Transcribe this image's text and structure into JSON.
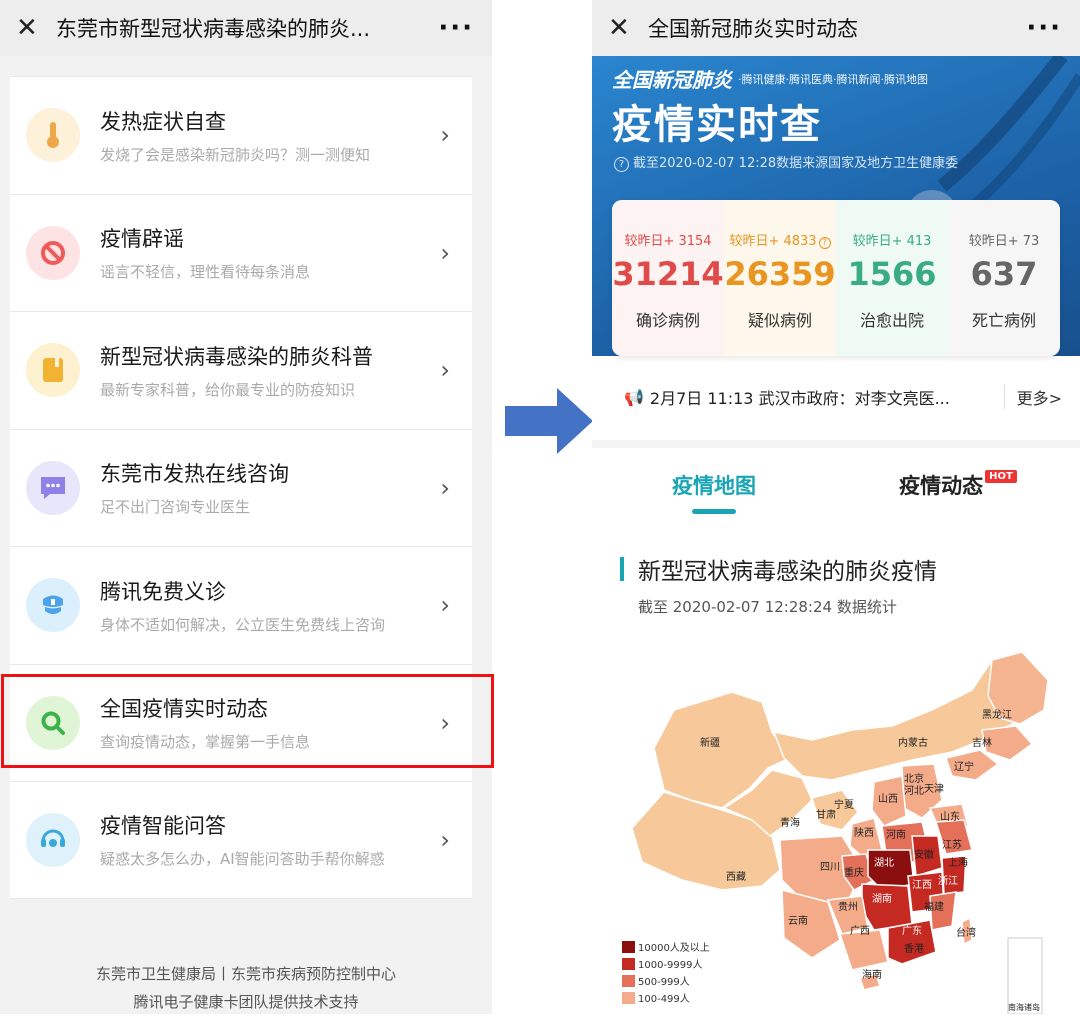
{
  "left": {
    "topbar": {
      "close_icon": "close-icon",
      "title": "东莞市新型冠状病毒感染的肺炎...",
      "more": "···"
    },
    "items": [
      {
        "title": "发热症状自查",
        "subtitle": "发烧了会是感染新冠肺炎吗？测一测便知",
        "icon": "thermometer-icon",
        "bg": "#fdf1d9",
        "fg": "#f0a64a"
      },
      {
        "title": "疫情辟谣",
        "subtitle": "谣言不轻信，理性看待每条消息",
        "icon": "prohibited-icon",
        "bg": "#fde3e3",
        "fg": "#ee5b5b"
      },
      {
        "title": "新型冠状病毒感染的肺炎科普",
        "subtitle": "最新专家科普，给你最专业的防疫知识",
        "icon": "book-icon",
        "bg": "#fdf1cf",
        "fg": "#f3b332"
      },
      {
        "title": "东莞市发热在线咨询",
        "subtitle": "足不出门咨询专业医生",
        "icon": "chat-icon",
        "bg": "#e8e6fa",
        "fg": "#8e82e8"
      },
      {
        "title": "腾讯免费义诊",
        "subtitle": "身体不适如何解决，公立医生免费线上咨询",
        "icon": "doctor-icon",
        "bg": "#dceffd",
        "fg": "#4da3ea"
      },
      {
        "title": "全国疫情实时动态",
        "subtitle": "查询疫情动态，掌握第一手信息",
        "icon": "search-icon",
        "bg": "#dff5d6",
        "fg": "#3db24a"
      },
      {
        "title": "疫情智能问答",
        "subtitle": "疑惑太多怎么办，AI智能问答助手帮你解惑",
        "icon": "robot-icon",
        "bg": "#dff1fb",
        "fg": "#3aa7d9"
      }
    ],
    "footer": {
      "line1": "东莞市卫生健康局丨东莞市疾病预防控制中心",
      "line2": "腾讯电子健康卡团队提供技术支持"
    },
    "highlight_color": "#e11111"
  },
  "arrow_color": "#4472c4",
  "right": {
    "topbar": {
      "close_icon": "close-icon",
      "title": "全国新冠肺炎实时动态",
      "more": "···"
    },
    "banner": {
      "title_small": "全国新冠肺炎",
      "partners": "·腾讯健康·腾讯医典·腾讯新闻·腾讯地图",
      "title_big": "疫情实时查",
      "date_line": "截至2020-02-07 12:28数据来源国家及地方卫生健康委"
    },
    "stats": [
      {
        "delta": "较昨日+ 3154",
        "value": "31214",
        "label": "确诊病例",
        "color": "#e04a48",
        "bg": "#fdf3f2"
      },
      {
        "delta": "较昨日+ 4833",
        "value": "26359",
        "label": "疑似病例",
        "color": "#e89521",
        "bg": "#fdf7ec"
      },
      {
        "delta": "较昨日+ 413",
        "value": "1566",
        "label": "治愈出院",
        "color": "#3aac84",
        "bg": "#f0faf5"
      },
      {
        "delta": "较昨日+ 73",
        "value": "637",
        "label": "死亡病例",
        "color": "#666666",
        "bg": "#f6f6f6"
      }
    ],
    "news": {
      "icon": "megaphone-icon",
      "text": "2月7日 11:13 武汉市政府：对李文亮医...",
      "more": "更多>"
    },
    "tabs": {
      "map": "疫情地图",
      "news": "疫情动态",
      "hot": "HOT"
    },
    "section": {
      "title": "新型冠状病毒感染的肺炎疫情",
      "subtitle": "截至 2020-02-07 12:28:24 数据统计"
    },
    "map": {
      "labels": [
        "黑龙江",
        "吉林",
        "辽宁",
        "内蒙古",
        "新疆",
        "北京",
        "天津",
        "河北",
        "山西",
        "宁夏",
        "甘肃",
        "山东",
        "陕西",
        "青海",
        "河南",
        "江苏",
        "安徽",
        "上海",
        "四川",
        "湖北",
        "重庆",
        "江西",
        "浙江",
        "西藏",
        "贵州",
        "湖南",
        "福建",
        "云南",
        "广西",
        "广东",
        "台湾",
        "香港",
        "海南",
        "南海诸岛"
      ],
      "legend": [
        "10000人及以上",
        "1000-9999人",
        "500-999人",
        "100-499人"
      ],
      "legend_colors": [
        "#8b0f0f",
        "#c42a22",
        "#e5705a",
        "#f4ab8a"
      ]
    }
  }
}
